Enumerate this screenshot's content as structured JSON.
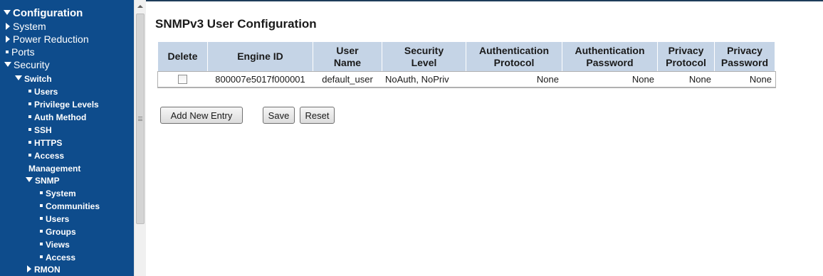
{
  "sidebar": {
    "items": [
      {
        "label": "Configuration"
      },
      {
        "label": "System"
      },
      {
        "label": "Power Reduction"
      },
      {
        "label": "Ports"
      },
      {
        "label": "Security"
      },
      {
        "label": "Switch"
      },
      {
        "label": "Users"
      },
      {
        "label": "Privilege Levels"
      },
      {
        "label": "Auth Method"
      },
      {
        "label": "SSH"
      },
      {
        "label": "HTTPS"
      },
      {
        "label": "Access"
      },
      {
        "label": "Management"
      },
      {
        "label": "SNMP"
      },
      {
        "label": "System"
      },
      {
        "label": "Communities"
      },
      {
        "label": "Users"
      },
      {
        "label": "Groups"
      },
      {
        "label": "Views"
      },
      {
        "label": "Access"
      },
      {
        "label": "RMON"
      }
    ]
  },
  "page": {
    "title": "SNMPv3 User Configuration"
  },
  "table": {
    "headers": {
      "delete": "Delete",
      "engine_id": "Engine ID",
      "user_name_1": "User",
      "user_name_2": "Name",
      "security_level_1": "Security",
      "security_level_2": "Level",
      "auth_protocol_1": "Authentication",
      "auth_protocol_2": "Protocol",
      "auth_password_1": "Authentication",
      "auth_password_2": "Password",
      "privacy_protocol_1": "Privacy",
      "privacy_protocol_2": "Protocol",
      "privacy_password_1": "Privacy",
      "privacy_password_2": "Password"
    },
    "rows": [
      {
        "delete_checked": false,
        "engine_id": "800007e5017f000001",
        "user_name": "default_user",
        "security_level": "NoAuth, NoPriv",
        "auth_protocol": "None",
        "auth_password": "None",
        "privacy_protocol": "None",
        "privacy_password": "None"
      }
    ]
  },
  "buttons": {
    "add_new_entry": "Add New Entry",
    "save": "Save",
    "reset": "Reset"
  },
  "colors": {
    "sidebar_bg": "#0e4c8c",
    "header_bg": "#c5d4e6"
  }
}
